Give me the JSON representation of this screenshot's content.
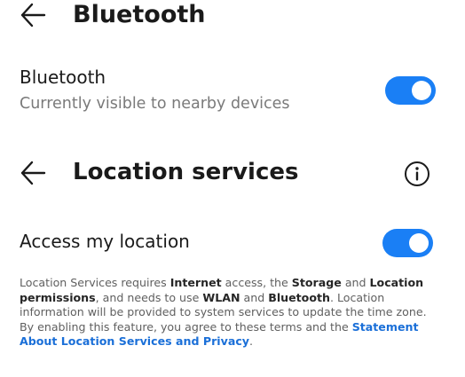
{
  "bluetooth_page": {
    "header": {
      "back_icon": "arrow-left-icon",
      "title": "Bluetooth"
    },
    "bluetooth_row": {
      "title": "Bluetooth",
      "subtitle": "Currently visible to nearby devices",
      "toggle_on": true
    }
  },
  "location_page": {
    "header": {
      "back_icon": "arrow-left-icon",
      "title": "Location services",
      "info_icon": "info-icon"
    },
    "access_row": {
      "title": "Access my location",
      "toggle_on": true
    },
    "description": {
      "t1": "Location Services requires ",
      "b1": "Internet",
      "t2": " access, the ",
      "b2": "Storage",
      "t3": " and ",
      "b3": "Location permissions",
      "t4": ", and needs to use ",
      "b4": "WLAN",
      "t5": " and ",
      "b5": "Bluetooth",
      "t6": ". Location information will be provided to system services to update the time zone. By enabling this feature, you agree to these terms and the ",
      "link": "Statement About Location Services and Privacy",
      "t7": "."
    }
  },
  "colors": {
    "accent": "#1a7ff5",
    "link": "#1a6fd8",
    "background": "#ffffff",
    "text_primary": "#1a1a1a",
    "text_secondary": "#7a7a7a"
  }
}
